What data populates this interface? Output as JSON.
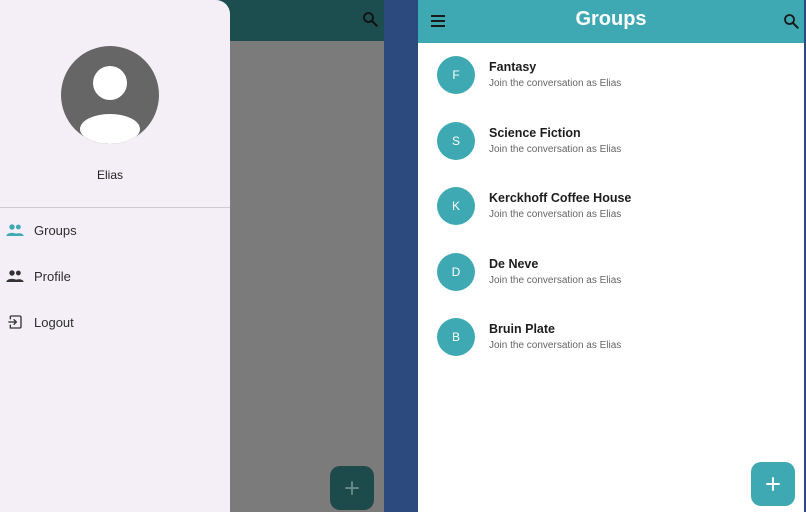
{
  "left_screen": {
    "drawer": {
      "user_name": "Elias",
      "items": [
        {
          "label": "Groups",
          "icon": "people-icon"
        },
        {
          "label": "Profile",
          "icon": "people-icon"
        },
        {
          "label": "Logout",
          "icon": "logout-icon"
        }
      ]
    },
    "fab_icon": "plus-icon"
  },
  "right_screen": {
    "app_bar": {
      "title": "Groups",
      "menu_icon": "menu-icon",
      "search_icon": "search-icon"
    },
    "groups": [
      {
        "initial": "F",
        "name": "Fantasy",
        "subtitle": "Join the conversation as Elias"
      },
      {
        "initial": "S",
        "name": "Science Fiction",
        "subtitle": "Join the conversation as Elias"
      },
      {
        "initial": "K",
        "name": "Kerckhoff Coffee House",
        "subtitle": "Join the conversation as Elias"
      },
      {
        "initial": "D",
        "name": "De Neve",
        "subtitle": "Join the conversation as Elias"
      },
      {
        "initial": "B",
        "name": "Bruin Plate",
        "subtitle": "Join the conversation as Elias"
      }
    ],
    "fab_icon": "plus-icon"
  },
  "colors": {
    "accent": "#3ea9b3",
    "drawer_bg": "#f4eff7",
    "dark_appbar": "#1c4d4f",
    "scrim": "#7b7b7b",
    "separator": "#2c4a7d"
  }
}
